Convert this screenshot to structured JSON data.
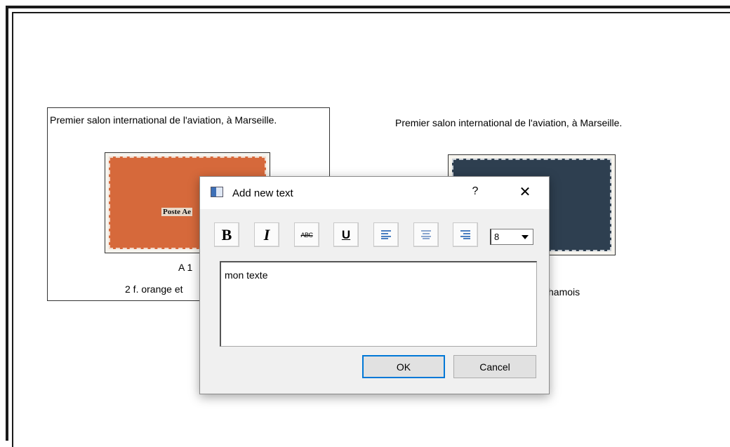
{
  "stamps": [
    {
      "caption": "Premier salon international de l'aviation, à Marseille.",
      "catalog_number": "A 1",
      "description": "2 f. orange et",
      "overprint": "Poste Ae"
    },
    {
      "caption": "Premier salon international de l'aviation, à Marseille.",
      "description": "hamois"
    }
  ],
  "dialog": {
    "title": "Add new text",
    "help_label": "?",
    "close_label": "✕",
    "toolbar": {
      "bold_label": "B",
      "italic_label": "I",
      "strike_label": "ABC",
      "underline_label": "U"
    },
    "font_size": "8",
    "text_value": "mon texte",
    "ok_label": "OK",
    "cancel_label": "Cancel"
  },
  "colors": {
    "stamp_left": "#d6693b",
    "stamp_right": "#2e3f50",
    "align_icon": "#4a7fc1"
  }
}
